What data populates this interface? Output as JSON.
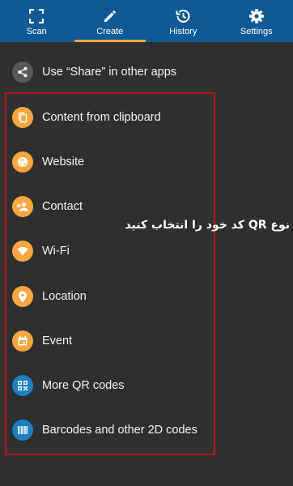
{
  "tabs": [
    {
      "label": "Scan",
      "icon": "scan-icon"
    },
    {
      "label": "Create",
      "icon": "pencil-icon",
      "active": true
    },
    {
      "label": "History",
      "icon": "history-icon"
    },
    {
      "label": "Settings",
      "icon": "gear-icon"
    }
  ],
  "share": {
    "label": "Use “Share” in other apps",
    "icon": "share-icon"
  },
  "items": [
    {
      "label": "Content from clipboard",
      "icon": "clipboard-icon"
    },
    {
      "label": "Website",
      "icon": "globe-icon"
    },
    {
      "label": "Contact",
      "icon": "add-contact-icon"
    },
    {
      "label": "Wi-Fi",
      "icon": "wifi-icon"
    },
    {
      "label": "Location",
      "icon": "location-pin-icon"
    },
    {
      "label": "Event",
      "icon": "calendar-icon"
    },
    {
      "label": "More QR codes",
      "icon": "qr-code-icon"
    },
    {
      "label": "Barcodes and other 2D codes",
      "icon": "barcode-icon"
    }
  ],
  "annotation": "نوع QR کد خود را انتخاب کنید",
  "colors": {
    "topbar": "#0f5a96",
    "accent": "#f6a740",
    "orange_icon": "#f6a740",
    "blue_icon": "#1e7fc1",
    "gray_icon": "#5a5a5a",
    "frame": "#b5121b",
    "background": "#2f2f2f"
  }
}
